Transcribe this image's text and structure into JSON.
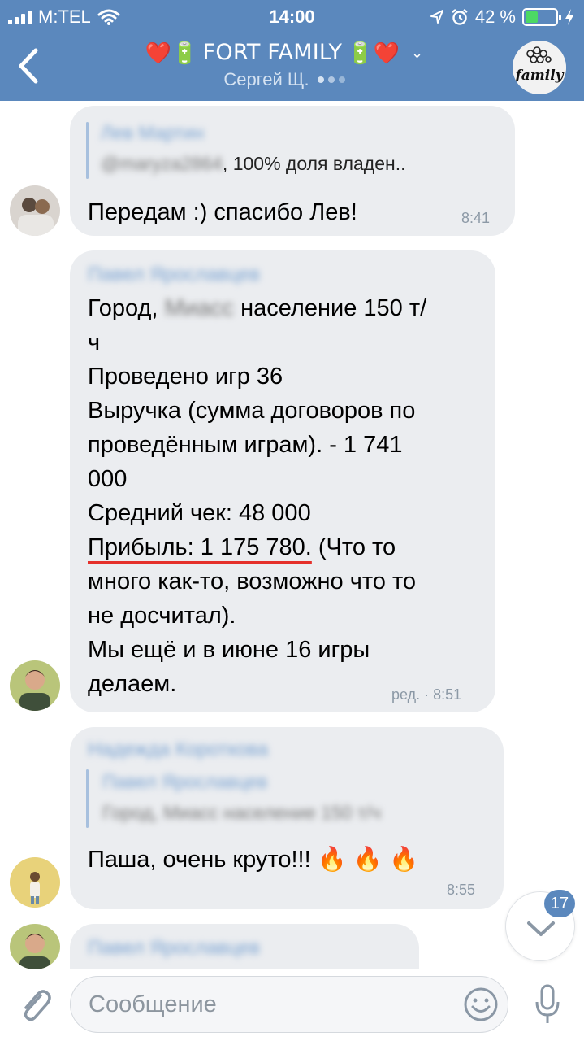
{
  "status_bar": {
    "carrier": "M:TEL",
    "time": "14:00",
    "battery": "42 %",
    "icons": [
      "signal-icon",
      "wifi-icon",
      "location-arrow-icon",
      "alarm-clock-icon",
      "battery-icon",
      "charging-bolt-icon"
    ]
  },
  "header": {
    "title_left_glyphs": "❤️🔋",
    "title": "FORT FAMILY",
    "title_right_glyphs": "🔋❤️",
    "typing_user": "Сергей Щ.",
    "chat_avatar_text": "family",
    "accent_color": "#5b88bd"
  },
  "messages": [
    {
      "reply_name": "Лев Мартин",
      "reply_blurred": "@maryza2864",
      "reply_text": ", 100% доля владен..",
      "text_lines": [
        "Передам :) спасибо Лев!"
      ],
      "time": "8:41"
    },
    {
      "sender": "Павел Ярославцев",
      "line1_pre": "Город,",
      "line1_blurred": "Миасс",
      "line1_post": " население 150 т/",
      "lines_a": [
        "ч",
        "Проведено игр 36",
        "Выручка (сумма договоров по",
        "проведённым играм). - 1 741",
        "000",
        "Средний чек: 48 000"
      ],
      "profit_underlined": "Прибыль: 1 175 780.",
      "profit_rest": " (Что то",
      "lines_b": [
        "много как-то, возможно что то",
        "не досчитал).",
        "Мы ещё и в июне 16 игры",
        "делаем."
      ],
      "time": "ред. · 8:51"
    },
    {
      "sender": "Надежда Короткова",
      "reply_name": "Павел Ярославцев",
      "reply_blurred": "Город, Миасс население 150 т/ч",
      "text": "Паша, очень круто!!! 🔥 🔥 🔥",
      "time": "8:55"
    },
    {
      "sender": "Павел Ярославцев"
    }
  ],
  "scroll_down": {
    "unread_count": "17"
  },
  "composer": {
    "placeholder": "Сообщение"
  }
}
